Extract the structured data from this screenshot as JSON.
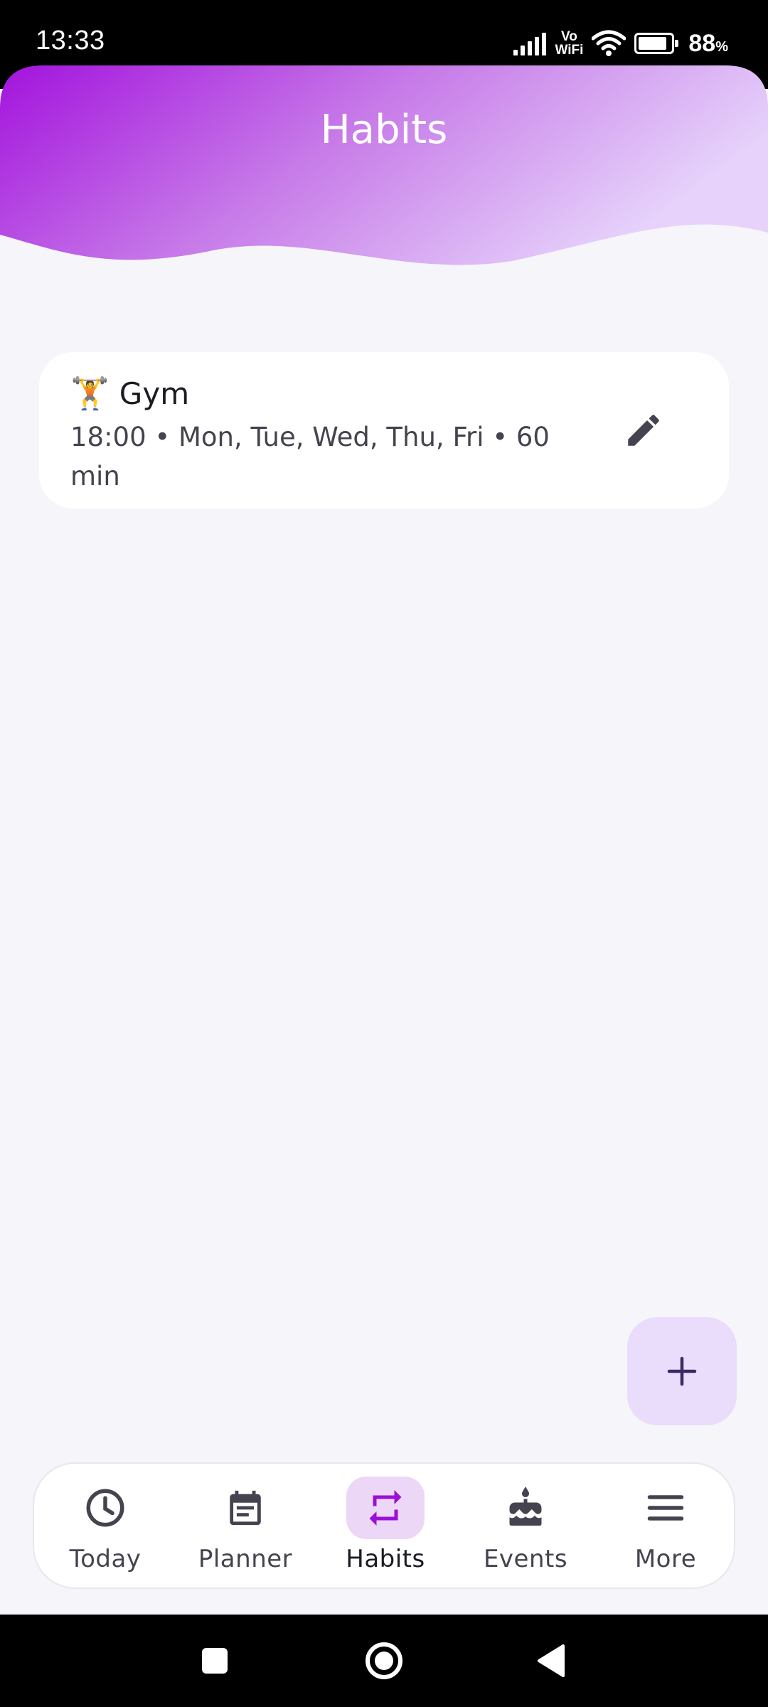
{
  "status_bar": {
    "time": "13:33",
    "vowifi_top": "Vo",
    "vowifi_bottom": "WiFi",
    "battery_percent": "88",
    "battery_unit": "%",
    "battery_level": 0.88
  },
  "header": {
    "title": "Habits",
    "gradient_colors": [
      "#a313dd",
      "#c77ae8",
      "#e6d2fb"
    ]
  },
  "habits": [
    {
      "emoji": "🏋️",
      "name": "Gym",
      "details": "18:00 • Mon, Tue, Wed, Thu, Fri • 60 min",
      "icon": "edit-icon"
    }
  ],
  "fab": {
    "icon": "plus-icon"
  },
  "bottom_nav": {
    "items": [
      {
        "label": "Today",
        "icon": "clock-icon",
        "active": false
      },
      {
        "label": "Planner",
        "icon": "calendar-icon",
        "active": false
      },
      {
        "label": "Habits",
        "icon": "repeat-icon",
        "active": true
      },
      {
        "label": "Events",
        "icon": "cake-icon",
        "active": false
      },
      {
        "label": "More",
        "icon": "menu-icon",
        "active": false
      }
    ]
  },
  "system_nav": {
    "buttons": [
      "recents-icon",
      "home-icon",
      "back-icon"
    ]
  },
  "colors": {
    "accent": "#9c0fd6",
    "background": "#f6f5fa",
    "fab": "#eadcfb",
    "active_nav_pill": "#ecd7f7"
  }
}
